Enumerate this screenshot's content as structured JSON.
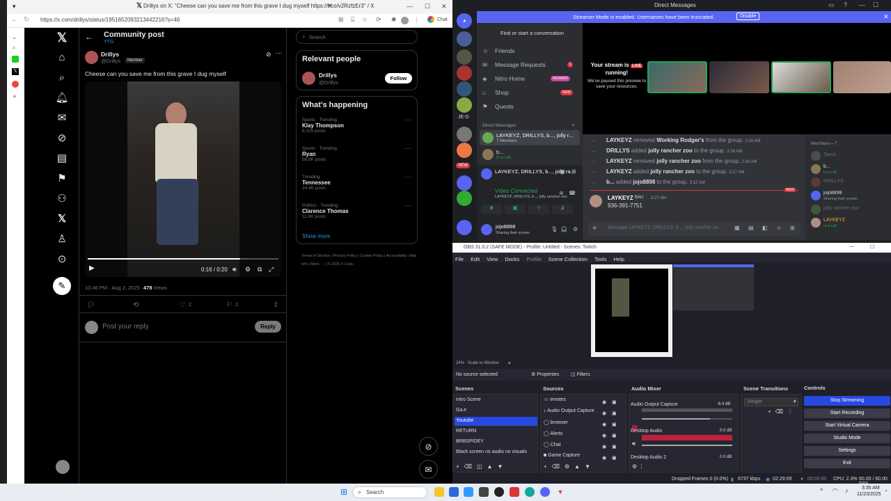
{
  "browser": {
    "tab_title": "Drillys on X: \"Cheese can you save me from this grave I dug myself https://t.co/v2RzfzEr3\" / X",
    "url": "https://x.com/drillys/status/1951652093213442216?s=46",
    "chat_label": "Chat"
  },
  "x": {
    "header_title": "Community post",
    "header_sub": "YTG",
    "author_name": "Drillys",
    "author_handle": "@Drillys",
    "member_badge": "Member",
    "post_text": "Cheese can you save me from this grave I dug myself",
    "video_time": "0:16 / 0:20",
    "video_progress": 0.8,
    "timestamp": "10:46 PM · Aug 2, 2025 ·",
    "views_count": "478",
    "views_label": "Views",
    "likes": "2",
    "bookmarks": "2",
    "reply_placeholder": "Post your reply",
    "reply_button": "Reply",
    "search_placeholder": "Search",
    "relevant_title": "Relevant people",
    "relevant_name": "Drillys",
    "relevant_handle": "@Drillys",
    "follow_label": "Follow",
    "happening_title": "What's happening",
    "trends": [
      {
        "cat": "Sports · Trending",
        "name": "Klay Thompson",
        "count": "9,155 posts"
      },
      {
        "cat": "Sports · Trending",
        "name": "Ryan",
        "count": "58.8K posts"
      },
      {
        "cat": "Trending",
        "name": "Tennessee",
        "count": "24.4K posts"
      },
      {
        "cat": "Politics · Trending",
        "name": "Clarence Thomas",
        "count": "11.6K posts"
      }
    ],
    "show_more": "Show more",
    "footer_links": [
      "Terms of Service",
      "Privacy Policy",
      "Cookie Policy",
      "Accessibility",
      "Ads info",
      "More ···",
      "© 2025 X Corp."
    ]
  },
  "discord": {
    "window_title": "Direct Messages",
    "banner_text": "Streamer Mode is enabled. Usernames have been truncated.",
    "banner_button": "Disable",
    "find_placeholder": "Find or start a conversation",
    "nav": [
      {
        "label": "Friends",
        "icon": "friends-icon"
      },
      {
        "label": "Message Requests",
        "badge": "1",
        "icon": "mail-icon"
      },
      {
        "label": "Nitro Home",
        "badge": "REWARD",
        "icon": "nitro-icon"
      },
      {
        "label": "Shop",
        "badge": "NEW",
        "icon": "shop-icon"
      },
      {
        "label": "Quests",
        "icon": "quests-icon"
      }
    ],
    "dm_header": "Direct Messages",
    "dm_group_name": "LAYKEYZ, DRILLYS, b..., jolly r...",
    "dm_group_members": "7 Members",
    "dm_user2": "b...",
    "dm_user2_status": "In a call",
    "voice_group_name": "LAYKEYZ, DRILLYS, b..., jolly ra...",
    "voice_group_sub": "LAYKEYZ, DRILLYS, b..., jolly rancher zoo",
    "video_connected": "Video Connected",
    "self_name": "jojo8898",
    "self_status": "Sharing their screen",
    "stream_running_line1": "Your stream is",
    "live_badge": "LIVE",
    "stream_running_line2": "running!",
    "stream_paused": "We've paused this preview to save your resources.",
    "guild_labels": [
      "JE-D",
      "NEW"
    ],
    "chat": [
      {
        "name": "LAYKEYZ",
        "action": "removed",
        "target": "Working Rodger's",
        "rest": "from the group.",
        "time": "2:16 AM",
        "dir": "left"
      },
      {
        "name": "DRILLYS",
        "action": "added",
        "target": "jolly rancher zoo",
        "rest": "to the group.",
        "time": "2:16 AM",
        "dir": "right"
      },
      {
        "name": "LAYKEYZ",
        "action": "removed",
        "target": "jolly rancher zoo",
        "rest": "from the group.",
        "time": "2:16 AM",
        "dir": "left"
      },
      {
        "name": "LAYKEYZ",
        "action": "added",
        "target": "jolly rancher zoo",
        "rest": "to the group.",
        "time": "2:17 AM",
        "dir": "right"
      },
      {
        "name": "b...",
        "action": "added",
        "target": "jojo8898",
        "rest": "to the group.",
        "time": "3:12 AM",
        "dir": "right"
      }
    ],
    "new_divider": "NEW",
    "msg_author": "LAYKEYZ",
    "msg_badge": "BAU",
    "msg_time": "3:27 AM",
    "msg_text": "936-391-7751",
    "message_placeholder": "Message LAYKEYZ, DRILLYS, b..., jolly rancher zo...",
    "members_header": "Members—7",
    "members": [
      {
        "name": "Sanct",
        "status": ""
      },
      {
        "name": "b...",
        "status": "In a call"
      },
      {
        "name": "DRILLYS",
        "status": ""
      },
      {
        "name": "jojo8898",
        "status": "Sharing their screen"
      },
      {
        "name": "jolly rancher zoo",
        "status": ""
      },
      {
        "name": "LAYKEYZ",
        "status": "In a call"
      }
    ]
  },
  "obs": {
    "title": "OBS 31.0.2 (SAFE MODE) - Profile: Untitled - Scenes: Twitch",
    "menu": [
      "File",
      "Edit",
      "View",
      "Docks",
      "Profile",
      "Scene Collection",
      "Tools",
      "Help"
    ],
    "zoom": "24%",
    "scale_label": "Scale to Window",
    "no_source": "No source selected",
    "properties": "Properties",
    "filters": "Filters",
    "scenes_header": "Scenes",
    "scenes": [
      "Intro Scene",
      "Ga.e",
      "Youtube",
      "RETURN",
      "BRBSPIDEY",
      "Black screen no audio no visuals"
    ],
    "sources_header": "Sources",
    "sources": [
      "emotes",
      "Audio Output Capture",
      "browser",
      "Alerts",
      "Chat",
      "Game Capture"
    ],
    "mixer_header": "Audio Mixer",
    "mixer": [
      {
        "name": "Audio Output Capture",
        "db": "-6.4 dB"
      },
      {
        "name": "Desktop Audio",
        "db": "0.0 dB"
      },
      {
        "name": "Desktop Audio 2",
        "db": "0.0 dB"
      }
    ],
    "transitions_header": "Scene Transitions",
    "transition_value": "Stinger",
    "controls_header": "Controls",
    "controls": [
      "Stop Streaming",
      "Start Recording",
      "Start Virtual Camera",
      "Studio Mode",
      "Settings",
      "Exit"
    ],
    "status": {
      "dropped": "Dropped Frames 0 (0.0%)",
      "kbps": "6737 kbps",
      "live_time": "02:29:09",
      "rec_time": "00:00:00",
      "cpu": "CPU: 2.3%",
      "fps": "60.00 / 60.00 FPS"
    }
  },
  "taskbar": {
    "search_placeholder": "Search",
    "time": "3:35 AM",
    "date": "11/23/2025"
  },
  "colors": {
    "x_blue": "#1d9bf0",
    "discord_blurple": "#5865f2",
    "obs_stream_blue": "#2848e0",
    "live_red": "#da373c"
  }
}
